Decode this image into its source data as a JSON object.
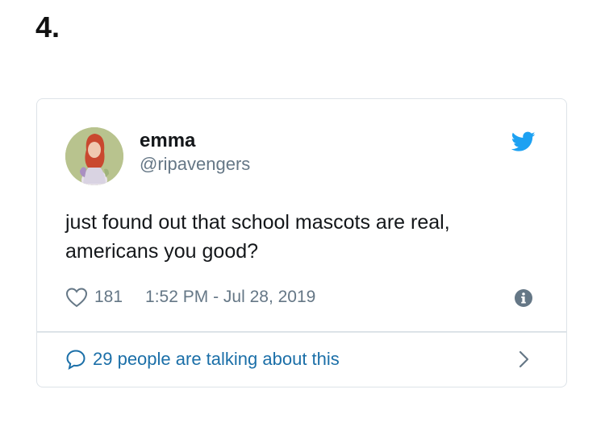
{
  "list_number": "4.",
  "tweet": {
    "display_name": "emma",
    "handle": "@ripavengers",
    "text_line1": "just found out that school mascots are real,",
    "text_line2": "americans you good?",
    "like_count": "181",
    "timestamp": "1:52 PM - Jul 28, 2019",
    "talking_label": "29 people are talking about this"
  },
  "icons": {
    "logo": "twitter-bird-icon",
    "like": "heart-icon",
    "info": "info-icon",
    "conversation": "speech-bubble-icon",
    "more": "chevron-right-icon"
  },
  "colors": {
    "twitter_blue": "#1da1f2",
    "link_blue": "#1b6fa8",
    "muted_gray": "#657786",
    "text_dark": "#14171a",
    "border": "#dde3e8"
  }
}
